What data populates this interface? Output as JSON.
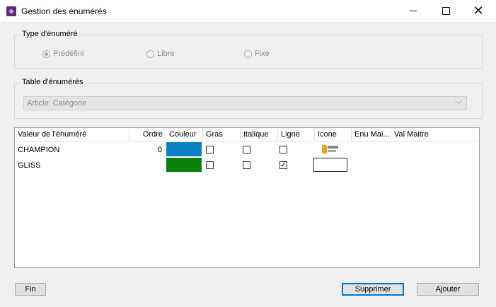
{
  "window": {
    "title": "Gestion des énumérés",
    "min_icon": "minimize-icon",
    "max_icon": "maximize-icon",
    "close_icon": "close-icon"
  },
  "type_group": {
    "legend": "Type d'énuméré",
    "options": [
      {
        "label": "Prédéfini",
        "selected": true
      },
      {
        "label": "Libre",
        "selected": false
      },
      {
        "label": "Fixe",
        "selected": false
      }
    ]
  },
  "table_group": {
    "legend": "Table d'énumérés",
    "selected_value": "Article: Catégorie"
  },
  "grid": {
    "columns": [
      "Valeur de l'énuméré",
      "Ordre",
      "Couleur",
      "Gras",
      "Italique",
      "Ligne",
      "Icone",
      "Enu Mai...",
      "Val Maitre"
    ],
    "rows": [
      {
        "valeur": "CHAMPION",
        "ordre": "0",
        "couleur": "#0a7fc3",
        "gras": false,
        "italique": false,
        "ligne": false,
        "icone": "logo-icon"
      },
      {
        "valeur": "GLISS",
        "ordre": "",
        "couleur": "#0a7f0a",
        "gras": false,
        "italique": false,
        "ligne": true,
        "icone": "empty-icon-box"
      }
    ]
  },
  "buttons": {
    "fin": "Fin",
    "supprimer": "Supprimer",
    "ajouter": "Ajouter"
  }
}
